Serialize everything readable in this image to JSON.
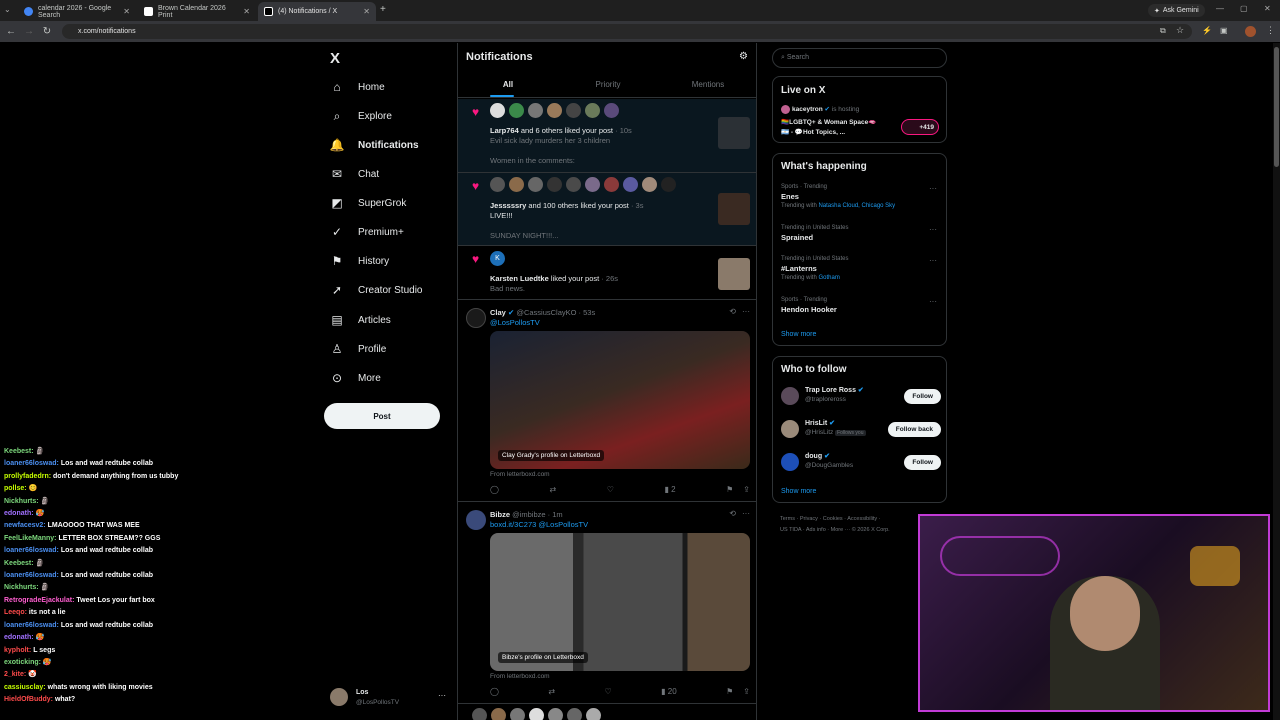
{
  "browser": {
    "tabs": [
      {
        "title": "calendar 2026 - Google Search",
        "color": "#4285f4"
      },
      {
        "title": "Brown Calendar 2026 Print",
        "color": "#ffffff"
      },
      {
        "title": "(4) Notifications / X",
        "color": "#ffffff"
      }
    ],
    "new_tab": "+",
    "ask_gemini": "Ask Gemini",
    "url": "x.com/notifications"
  },
  "nav": {
    "logo": "X",
    "items": [
      "Home",
      "Explore",
      "Notifications",
      "Chat",
      "SuperGrok",
      "Premium+",
      "History",
      "Creator Studio",
      "Articles",
      "Profile",
      "More"
    ],
    "post": "Post",
    "account_name": "Los",
    "account_handle": "@LosPollosTV"
  },
  "main": {
    "title": "Notifications",
    "tabs": [
      "All",
      "Priority",
      "Mentions"
    ],
    "n1": {
      "who": "Larp764",
      "text": "and 6 others liked your post",
      "time": "· 10s",
      "snippet": "Evil sick lady murders her 3 children",
      "sub": "Women in the comments:"
    },
    "n2": {
      "who": "Jesssssry",
      "text": "and 100 others liked your post",
      "time": "· 3s",
      "snippet": "LIVE!!!",
      "sub": "SUNDAY NIGHT!!!..."
    },
    "n3": {
      "who": "Karsten Luedtke",
      "text": "liked your post",
      "time": "· 26s",
      "snippet": "Bad news.",
      "avatar_letter": "K"
    },
    "t1": {
      "name": "Clay",
      "handle": "@CassiusClayKO · 53s",
      "text": "@LosPollosTV",
      "caption": "Clay Grady's profile on Letterboxd",
      "source": "From letterboxd.com",
      "views": "2"
    },
    "t2": {
      "name": "Bibze",
      "handle": "@imbibze · 1m",
      "text": "boxd.it/3C273 @LosPollosTV",
      "caption": "Bibze's profile on Letterboxd",
      "source": "From letterboxd.com",
      "views": "20"
    }
  },
  "right": {
    "search_placeholder": "Search",
    "live_title": "Live on X",
    "live_host": "kaceytron",
    "live_hosting": "is hosting",
    "live_text": "🏳️‍🌈LGBTQ+ & Woman Space🫦",
    "live_text2": "🇦🇷 - 💬Hot Topics, ...",
    "live_count": "+419",
    "happening_title": "What's happening",
    "trends": [
      {
        "sub": "Sports · Trending",
        "title": "Enes",
        "with": "Trending with",
        "links": "Natasha Cloud, Chicago Sky"
      },
      {
        "sub": "Trending in United States",
        "title": "Sprained",
        "with": "",
        "links": ""
      },
      {
        "sub": "Trending in United States",
        "title": "#Lanterns",
        "with": "Trending with",
        "links": "Gotham"
      },
      {
        "sub": "Sports · Trending",
        "title": "Hendon Hooker",
        "with": "",
        "links": ""
      }
    ],
    "show_more": "Show more",
    "wtf_title": "Who to follow",
    "follows": [
      {
        "name": "Trap Lore Ross",
        "handle": "@traploreross",
        "btn": "Follow",
        "tag": ""
      },
      {
        "name": "HrisLit",
        "handle": "@HrisLitz",
        "btn": "Follow back",
        "tag": "Follows you"
      },
      {
        "name": "doug",
        "handle": "@DougGambles",
        "btn": "Follow",
        "tag": ""
      }
    ],
    "show_more2": "Show more",
    "footer1": "Terms · Privacy · Cookies · Accessibility ·",
    "footer2": "US TIDA · Ads info · More ··· © 2026 X Corp."
  },
  "chat": [
    {
      "user": "Keebest:",
      "msg": "🗿",
      "color": "#7dd87d"
    },
    {
      "user": "loaner66loswad:",
      "msg": "Los and wad redtube collab",
      "color": "#4b8ff0"
    },
    {
      "user": "prollyfadedrn:",
      "msg": "don't demand anything from us tubby",
      "color": "#c6ff00"
    },
    {
      "user": "pollse:",
      "msg": "😊",
      "color": "#c6ff00"
    },
    {
      "user": "Nickhurts:",
      "msg": "🗿",
      "color": "#7dd87d"
    },
    {
      "user": "edonath:",
      "msg": "🥵",
      "color": "#a070ff"
    },
    {
      "user": "newfacesv2:",
      "msg": "LMAOOOO THAT WAS MEE",
      "color": "#4b8ff0"
    },
    {
      "user": "FeelLikeManny:",
      "msg": "LETTER BOX STREAM?? GGS",
      "color": "#7dd87d"
    },
    {
      "user": "loaner66loswad:",
      "msg": "Los and wad redtube collab",
      "color": "#4b8ff0"
    },
    {
      "user": "Keebest:",
      "msg": "🗿",
      "color": "#7dd87d"
    },
    {
      "user": "loaner66loswad:",
      "msg": "Los and wad redtube collab",
      "color": "#4b8ff0"
    },
    {
      "user": "Nickhurts:",
      "msg": "🗿",
      "color": "#7dd87d"
    },
    {
      "user": "RetrogradeEjackulat:",
      "msg": "Tweet Los your fart box",
      "color": "#ff5ed0"
    },
    {
      "user": "Leeqo:",
      "msg": "its not a lie",
      "color": "#ff4b4b"
    },
    {
      "user": "loaner66loswad:",
      "msg": "Los and wad redtube collab",
      "color": "#4b8ff0"
    },
    {
      "user": "edonath:",
      "msg": "🥵",
      "color": "#a070ff"
    },
    {
      "user": "kypholt:",
      "msg": "L segs",
      "color": "#ff4b4b"
    },
    {
      "user": "exoticking:",
      "msg": "🥵",
      "color": "#7dd87d"
    },
    {
      "user": "2_kite:",
      "msg": "🤡",
      "color": "#ff4b4b"
    },
    {
      "user": "cassiusclay:",
      "msg": "whats wrong with liking movies",
      "color": "#c6ff00"
    },
    {
      "user": "HieldOfBuddy:",
      "msg": "what?",
      "color": "#ff4b4b"
    }
  ]
}
